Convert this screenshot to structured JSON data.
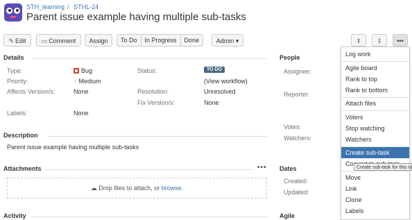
{
  "breadcrumb": {
    "project": "STH_learning",
    "separator": "/",
    "issue_key": "STHL-24"
  },
  "issue": {
    "title": "Parent issue example having multiple sub-tasks"
  },
  "toolbar": {
    "edit": "Edit",
    "comment": "Comment",
    "assign": "Assign",
    "to_do": "To Do",
    "in_progress": "In Progress",
    "done": "Done",
    "admin": "Admin"
  },
  "details": {
    "heading": "Details",
    "type_label": "Type:",
    "type_value": "Bug",
    "priority_label": "Priority:",
    "priority_value": "Medium",
    "affects_label": "Affects Version/s:",
    "affects_value": "None",
    "labels_label": "Labels:",
    "labels_value": "None",
    "status_label": "Status:",
    "status_value": "TO DO",
    "workflow_link": "(View workflow)",
    "resolution_label": "Resolution:",
    "resolution_value": "Unresolved",
    "fix_label": "Fix Version/s:",
    "fix_value": "None"
  },
  "description": {
    "heading": "Description",
    "text": "Parent issue example having multiple sub-tasks"
  },
  "attachments": {
    "heading": "Attachments",
    "drop_text": "Drop files to attach, or",
    "browse": "browse."
  },
  "activity": {
    "heading": "Activity"
  },
  "people": {
    "heading": "People",
    "assignee_label": "Assignee:",
    "reporter_label": "Reporter:",
    "votes_label": "Votes:",
    "watchers_label": "Watchers:"
  },
  "dates": {
    "heading": "Dates",
    "created_label": "Created:",
    "updated_label": "Updated:"
  },
  "agile": {
    "heading": "Agile"
  },
  "more_menu": {
    "items": [
      "Log work",
      "Agile board",
      "Rank to top",
      "Rank to bottom",
      "Attach files",
      "Voters",
      "Stop watching",
      "Watchers",
      "Create sub-task",
      "Convert to sub-task",
      "Move",
      "Link",
      "Clone",
      "Labels"
    ],
    "active": "Create sub-task",
    "tooltip": "Create sub-task for this issue"
  },
  "colors": {
    "accent": "#3b73af",
    "status_lozenge": "#4a6785",
    "bug": "#d04437",
    "menu_highlight": "#3b73af"
  }
}
